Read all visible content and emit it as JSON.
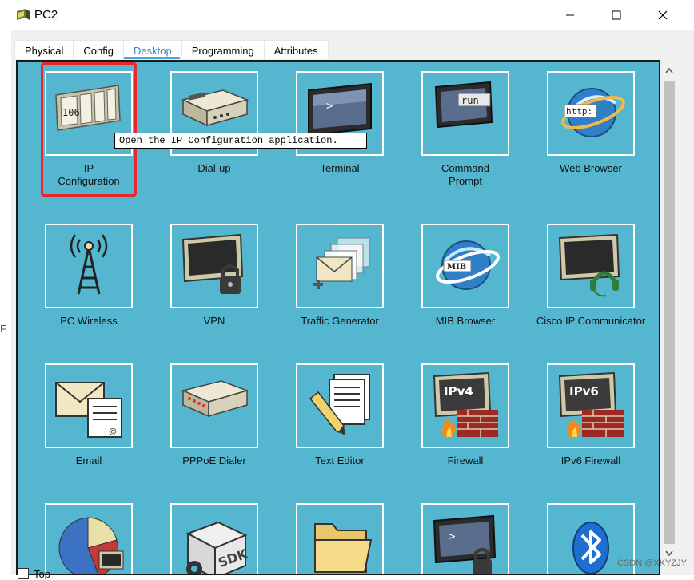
{
  "window": {
    "title": "PC2"
  },
  "tabs": [
    {
      "label": "Physical"
    },
    {
      "label": "Config"
    },
    {
      "label": "Desktop"
    },
    {
      "label": "Programming"
    },
    {
      "label": "Attributes"
    }
  ],
  "active_tab": "Desktop",
  "tooltip": "Open the IP Configuration application.",
  "apps": [
    {
      "label": "IP\nConfiguration",
      "icon": "ip-configuration-icon",
      "badge": "106"
    },
    {
      "label": "Dial-up",
      "icon": "modem-icon"
    },
    {
      "label": "Terminal",
      "icon": "terminal-icon",
      "badge": ">"
    },
    {
      "label": "Command\nPrompt",
      "icon": "command-prompt-icon",
      "badge": "run"
    },
    {
      "label": "Web Browser",
      "icon": "web-browser-icon",
      "badge": "http:"
    },
    {
      "label": "PC Wireless",
      "icon": "wireless-tower-icon"
    },
    {
      "label": "VPN",
      "icon": "vpn-lock-icon"
    },
    {
      "label": "Traffic Generator",
      "icon": "traffic-generator-icon"
    },
    {
      "label": "MIB Browser",
      "icon": "mib-browser-icon",
      "badge": "MIB"
    },
    {
      "label": "Cisco IP Communicator",
      "icon": "ip-communicator-headset-icon"
    },
    {
      "label": "Email",
      "icon": "email-icon"
    },
    {
      "label": "PPPoE Dialer",
      "icon": "pppoe-dialer-icon"
    },
    {
      "label": "Text Editor",
      "icon": "text-editor-icon"
    },
    {
      "label": "Firewall",
      "icon": "firewall-ipv4-icon",
      "badge": "IPv4"
    },
    {
      "label": "IPv6 Firewall",
      "icon": "firewall-ipv6-icon",
      "badge": "IPv6"
    },
    {
      "label": "",
      "icon": "pie-chart-icon"
    },
    {
      "label": "",
      "icon": "sdk-icon",
      "badge": "SDK"
    },
    {
      "label": "",
      "icon": "folder-icon"
    },
    {
      "label": "",
      "icon": "locked-terminal-icon",
      "badge": ">"
    },
    {
      "label": "",
      "icon": "bluetooth-icon"
    }
  ],
  "footer": {
    "top_label": "Top"
  },
  "watermark": "CSDN @XKYZJY",
  "side_fragment": "F",
  "colors": {
    "panel": "#55b6cf",
    "highlight": "#e8262c",
    "active_tab": "#3a89c9"
  }
}
